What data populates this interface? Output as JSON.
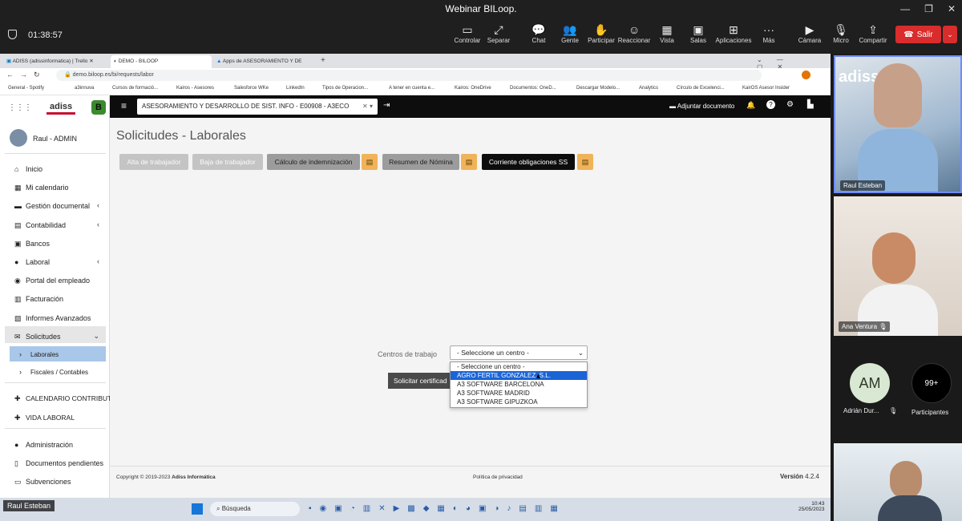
{
  "zoom": {
    "window_title": "Webinar BILoop.",
    "timer": "01:38:57",
    "toolbar": [
      {
        "label": "Controlar",
        "icon": "monitor-icon"
      },
      {
        "label": "Separar",
        "icon": "detach-icon"
      },
      {
        "label": "Chat",
        "icon": "chat-icon"
      },
      {
        "label": "Gente",
        "icon": "people-icon"
      },
      {
        "label": "Participar",
        "icon": "raise-hand-icon"
      },
      {
        "label": "Reaccionar",
        "icon": "smile-icon"
      },
      {
        "label": "Vista",
        "icon": "grid-icon"
      },
      {
        "label": "Salas",
        "icon": "rooms-icon"
      },
      {
        "label": "Aplicaciones",
        "icon": "plus-icon"
      },
      {
        "label": "Más",
        "icon": "more-icon"
      },
      {
        "label": "Cámara",
        "icon": "camera-icon"
      },
      {
        "label": "Micro",
        "icon": "mic-off-icon"
      },
      {
        "label": "Compartir",
        "icon": "share-icon"
      }
    ],
    "leave_label": "Salir",
    "presenter_label": "Raul Esteban",
    "participants": {
      "video1_name": "Raul Esteban",
      "video2_name": "Ana Ventura",
      "avatar_initials": "AM",
      "avatar_name": "Adrián Dur...",
      "count_label": "99+",
      "count_caption": "Participantes"
    }
  },
  "browser": {
    "tabs": [
      "ADISS (adissinformatica) | Trello",
      "DEMO - BILOOP",
      "Apps de ASESORAMIENTO Y DE"
    ],
    "url": "demo.biloop.es/bi/requests/labor",
    "bookmarks": [
      "General - Spotify",
      "a3innuva",
      "Cursos de formació...",
      "Kairos - Asesores",
      "Salesforce WKe",
      "LinkedIn",
      "Tipos de Operacion...",
      "A tener en cuenta e...",
      "Kairos: OneDrive",
      "Documentos: OneD...",
      "Descargar Modelo...",
      "Analytics",
      "Círculo de Excelenci...",
      "KairOS Asesor Insider"
    ]
  },
  "app": {
    "logo_text": "adiss",
    "user": "Raul - ADMIN",
    "company": "ASESORAMIENTO Y DESARROLLO DE SIST. INFO - E00908 - A3ECO",
    "attach_label": "Adjuntar documento",
    "menu": [
      {
        "label": "Inicio",
        "icon": "home-icon"
      },
      {
        "label": "Mi calendario",
        "icon": "calendar-icon"
      },
      {
        "label": "Gestión documental",
        "icon": "folder-icon"
      },
      {
        "label": "Contabilidad",
        "icon": "calculator-icon"
      },
      {
        "label": "Bancos",
        "icon": "bank-icon"
      },
      {
        "label": "Laboral",
        "icon": "person-icon"
      },
      {
        "label": "Portal del empleado",
        "icon": "globe-icon"
      },
      {
        "label": "Facturación",
        "icon": "invoice-icon"
      },
      {
        "label": "Informes Avanzados",
        "icon": "report-icon"
      },
      {
        "label": "Solicitudes",
        "icon": "inbox-icon"
      },
      {
        "label": "Laborales",
        "icon": "chevron-right-icon"
      },
      {
        "label": "Fiscales / Contables",
        "icon": "chevron-right-icon"
      },
      {
        "label": "CALENDARIO CONTRIBUT",
        "icon": "cross-icon"
      },
      {
        "label": "VIDA LABORAL",
        "icon": "cross-icon"
      },
      {
        "label": "Administración",
        "icon": "users-icon"
      },
      {
        "label": "Documentos pendientes",
        "icon": "doc-icon"
      },
      {
        "label": "Subvenciones",
        "icon": "subsidy-icon"
      }
    ],
    "page_title": "Solicitudes - Laborales",
    "buttons": [
      "Alta de trabajador",
      "Baja de trabajador",
      "Cálculo de indemnización",
      "Resumen de Nómina",
      "Corriente obligaciones SS"
    ],
    "field_label": "Centros de trabajo",
    "select_value": "- Seleccione un centro -",
    "options": [
      "- Seleccione un centro -",
      "AGRO FERTIL GONZALEZ, S.L.",
      "A3 SOFTWARE BARCELONA",
      "A3 SOFTWARE MADRID",
      "A3 SOFTWARE GIPUZKOA"
    ],
    "submit_label": "Solicitar certificad",
    "footer_copy": "Copyright © 2019-2023",
    "footer_company": "Adiss Informática",
    "footer_privacy": "Política de privacidad",
    "footer_version_label": "Versión",
    "footer_version": "4.2.4"
  },
  "taskbar": {
    "search": "Búsqueda",
    "time": "10:43",
    "date": "25/05/2023"
  },
  "colors": {
    "accent_dark": "#0d0d0d",
    "doc_button": "#f0b35a",
    "selected_option": "#1a64d6",
    "leave": "#d92d2d"
  }
}
